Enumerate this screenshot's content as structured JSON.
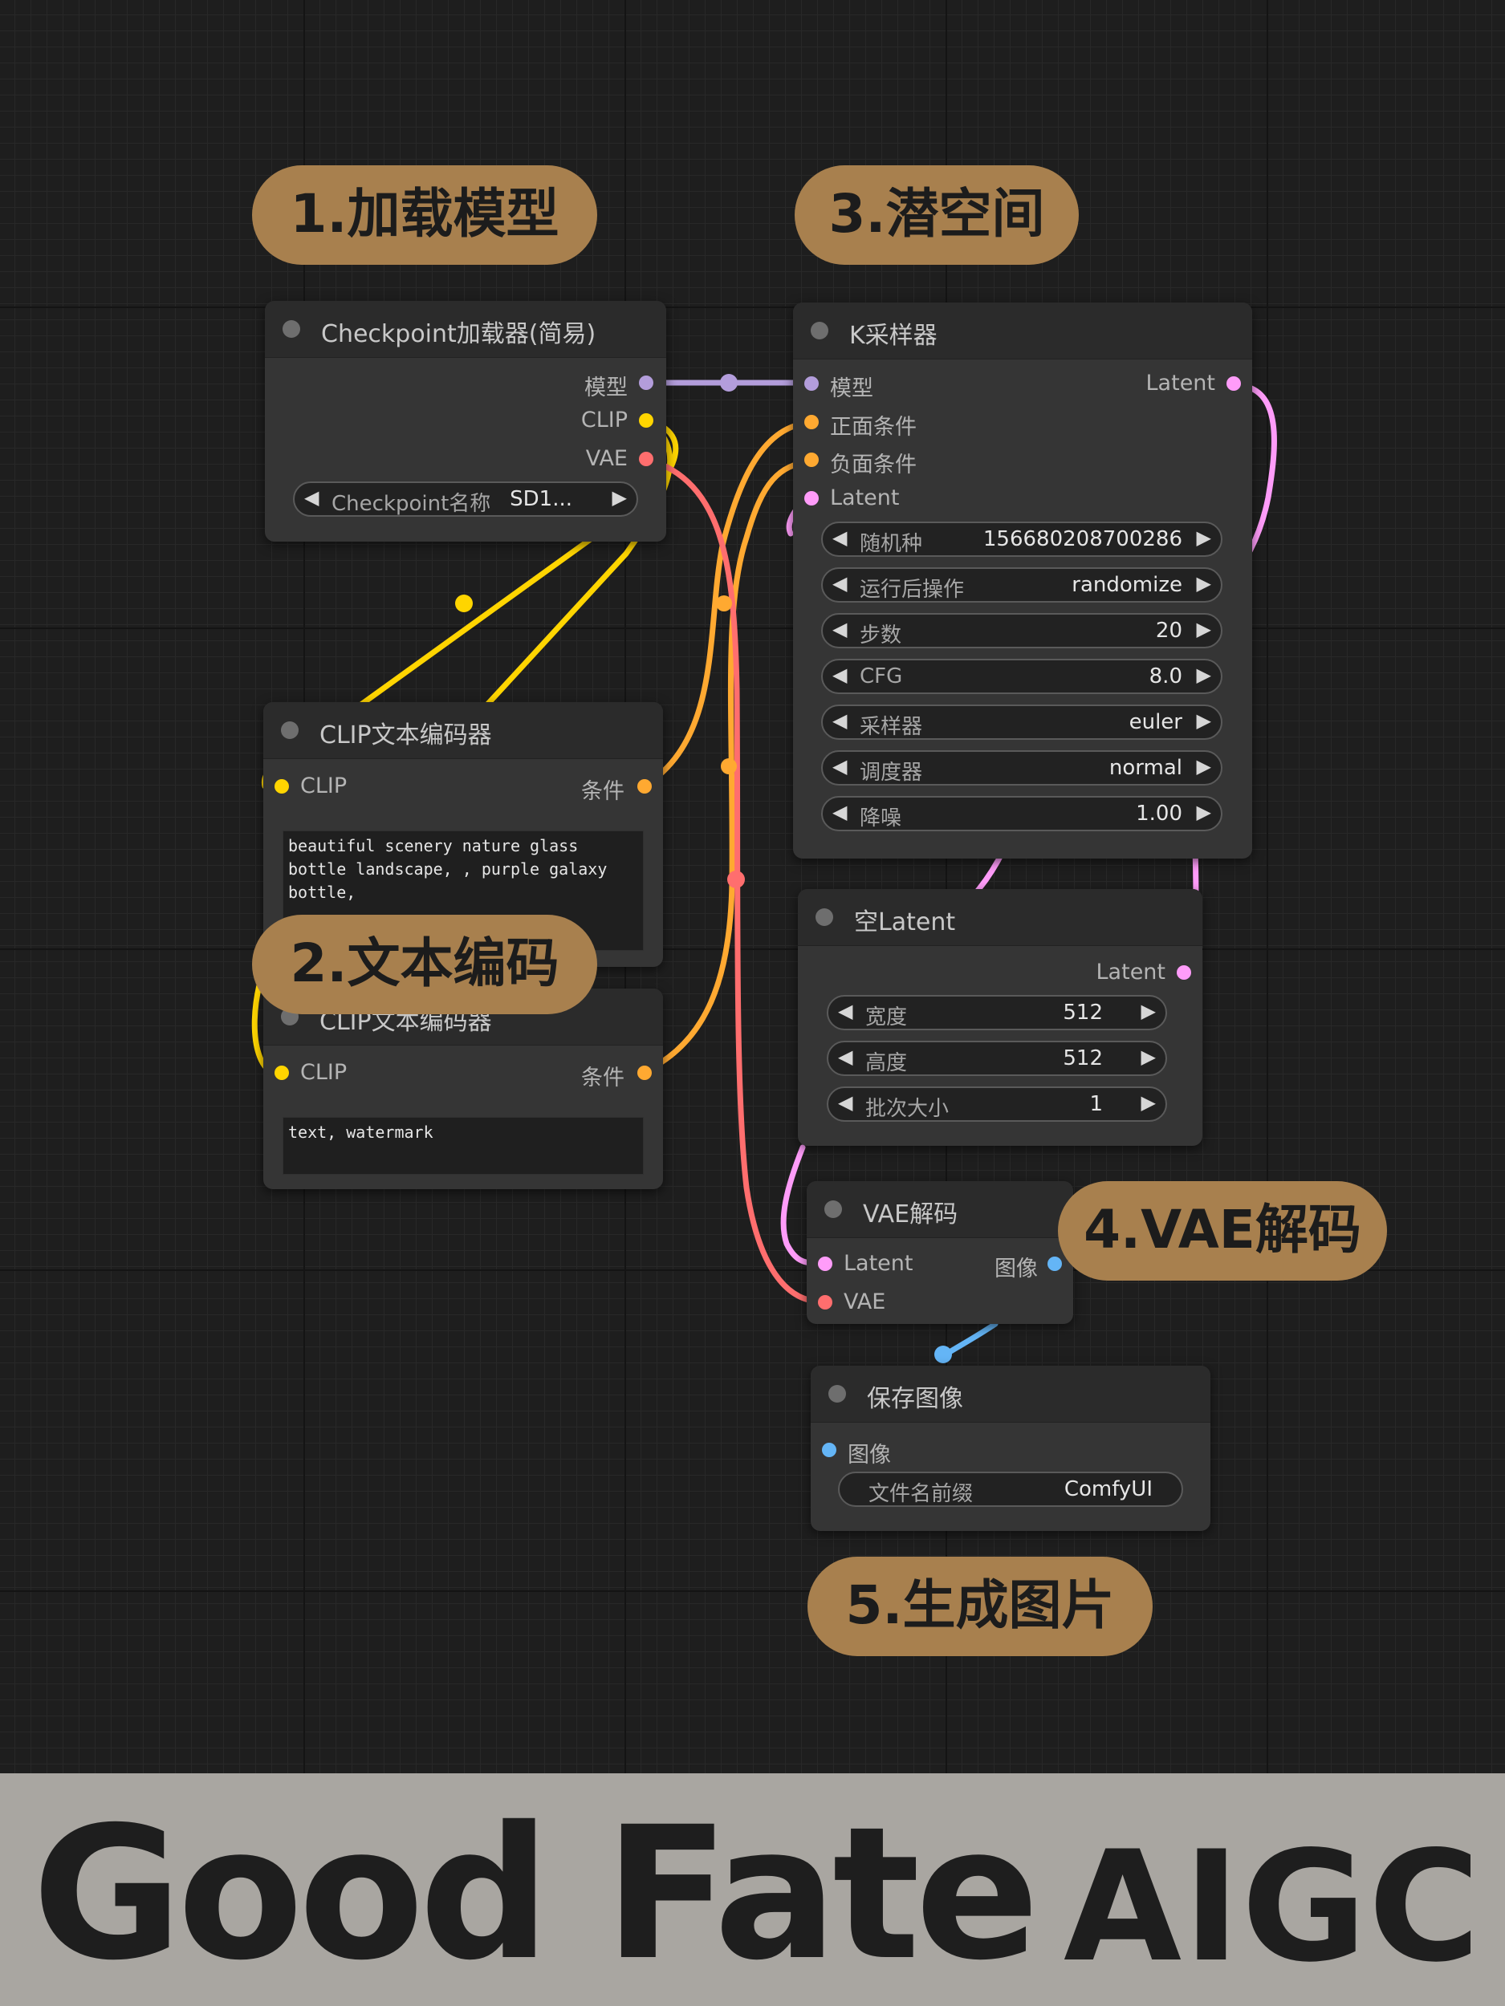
{
  "step_badges": {
    "step1": "1.加载模型",
    "step2": "2.文本编码",
    "step3": "3.潜空间",
    "step4": "4.VAE解码",
    "step5": "5.生成图片"
  },
  "checkpoint_loader": {
    "title": "Checkpoint加载器(简易)",
    "outputs": [
      "模型",
      "CLIP",
      "VAE"
    ],
    "widget": {
      "name": "Checkpoint名称",
      "value": "SD1..."
    }
  },
  "clip_encoder_positive": {
    "title": "CLIP文本编码器",
    "input": "CLIP",
    "output": "条件",
    "text": "beautiful scenery nature glass bottle landscape, , purple galaxy bottle,"
  },
  "clip_encoder_negative": {
    "title": "CLIP文本编码器",
    "input": "CLIP",
    "output": "条件",
    "text": "text, watermark"
  },
  "ksampler": {
    "title": "K采样器",
    "inputs": [
      "模型",
      "正面条件",
      "负面条件",
      "Latent"
    ],
    "output": "Latent",
    "widgets": [
      {
        "name": "随机种",
        "value": "156680208700286"
      },
      {
        "name": "运行后操作",
        "value": "randomize"
      },
      {
        "name": "步数",
        "value": "20"
      },
      {
        "name": "CFG",
        "value": "8.0"
      },
      {
        "name": "采样器",
        "value": "euler"
      },
      {
        "name": "调度器",
        "value": "normal"
      },
      {
        "name": "降噪",
        "value": "1.00"
      }
    ]
  },
  "empty_latent": {
    "title": "空Latent",
    "output": "Latent",
    "widgets": [
      {
        "name": "宽度",
        "value": "512"
      },
      {
        "name": "高度",
        "value": "512"
      },
      {
        "name": "批次大小",
        "value": "1"
      }
    ]
  },
  "vae_decode": {
    "title": "VAE解码",
    "inputs": [
      "Latent",
      "VAE"
    ],
    "output": "图像"
  },
  "save_image": {
    "title": "保存图像",
    "input": "图像",
    "widget": {
      "name": "文件名前缀",
      "value": "ComfyUI"
    }
  },
  "footer": {
    "brand_left": "Good Fate",
    "brand_right": "AIGC"
  },
  "icons": {
    "arrow_left": "◀",
    "arrow_right": "▶"
  },
  "colors": {
    "model": "#b39ddb",
    "clip": "#ffd500",
    "vae": "#ff6e6e",
    "conditioning": "#ffa931",
    "latent": "#ff9cf9",
    "image": "#64b5f6",
    "badge": "#a8804e"
  }
}
